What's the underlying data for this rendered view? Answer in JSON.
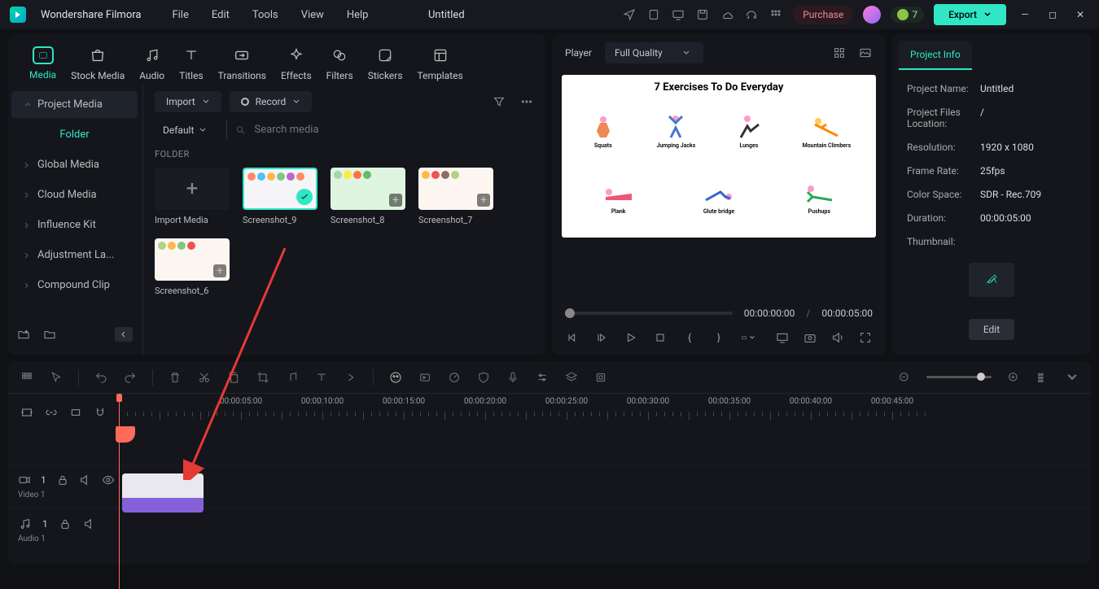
{
  "app": {
    "name": "Wondershare Filmora",
    "doc": "Untitled"
  },
  "menubar": [
    "File",
    "Edit",
    "Tools",
    "View",
    "Help"
  ],
  "header": {
    "purchase": "Purchase",
    "gems": "7",
    "export": "Export"
  },
  "tabs": [
    {
      "label": "Media",
      "active": true
    },
    {
      "label": "Stock Media"
    },
    {
      "label": "Audio"
    },
    {
      "label": "Titles"
    },
    {
      "label": "Transitions"
    },
    {
      "label": "Effects"
    },
    {
      "label": "Filters"
    },
    {
      "label": "Stickers"
    },
    {
      "label": "Templates"
    }
  ],
  "sidebar": {
    "items": [
      {
        "label": "Project Media",
        "sel": true
      },
      {
        "label": "Folder",
        "folder": true
      },
      {
        "label": "Global Media"
      },
      {
        "label": "Cloud Media"
      },
      {
        "label": "Influence Kit"
      },
      {
        "label": "Adjustment La..."
      },
      {
        "label": "Compound Clip"
      }
    ]
  },
  "content": {
    "import": "Import",
    "record": "Record",
    "sort": "Default",
    "search_ph": "Search media",
    "folder_label": "FOLDER",
    "import_media": "Import Media",
    "items": [
      {
        "name": "Screenshot_9",
        "sel": true,
        "kind": "ex"
      },
      {
        "name": "Screenshot_8",
        "kind": "fruits"
      },
      {
        "name": "Screenshot_7",
        "kind": "food"
      },
      {
        "name": "Screenshot_6",
        "kind": "food",
        "row2": true
      }
    ]
  },
  "player": {
    "label": "Player",
    "quality": "Full Quality",
    "preview_title": "7 Exercises To Do Everyday",
    "exercises": [
      [
        "Squats",
        "Jumping Jacks",
        "Lunges",
        "Mountain Climbers"
      ],
      [
        "Plank",
        "Glute bridge",
        "Pushups"
      ]
    ],
    "cur": "00:00:00:00",
    "dur": "00:00:05:00"
  },
  "info": {
    "tab": "Project Info",
    "rows": [
      {
        "l": "Project Name:",
        "v": "Untitled"
      },
      {
        "l": "Project Files Location:",
        "v": "/"
      },
      {
        "l": "Resolution:",
        "v": "1920 x 1080"
      },
      {
        "l": "Frame Rate:",
        "v": "25fps"
      },
      {
        "l": "Color Space:",
        "v": "SDR - Rec.709"
      },
      {
        "l": "Duration:",
        "v": "00:00:05:00"
      },
      {
        "l": "Thumbnail:",
        "v": ""
      }
    ],
    "edit": "Edit"
  },
  "timeline": {
    "marks": [
      "",
      "00:00:05:00",
      "00:00:10:00",
      "00:00:15:00",
      "00:00:20:00",
      "00:00:25:00",
      "00:00:30:00",
      "00:00:35:00",
      "00:00:40:00",
      "00:00:45:00"
    ],
    "tracks": [
      {
        "icon": "cam",
        "count": "1",
        "label": "Video 1"
      },
      {
        "icon": "note",
        "count": "1",
        "label": "Audio 1"
      }
    ]
  }
}
